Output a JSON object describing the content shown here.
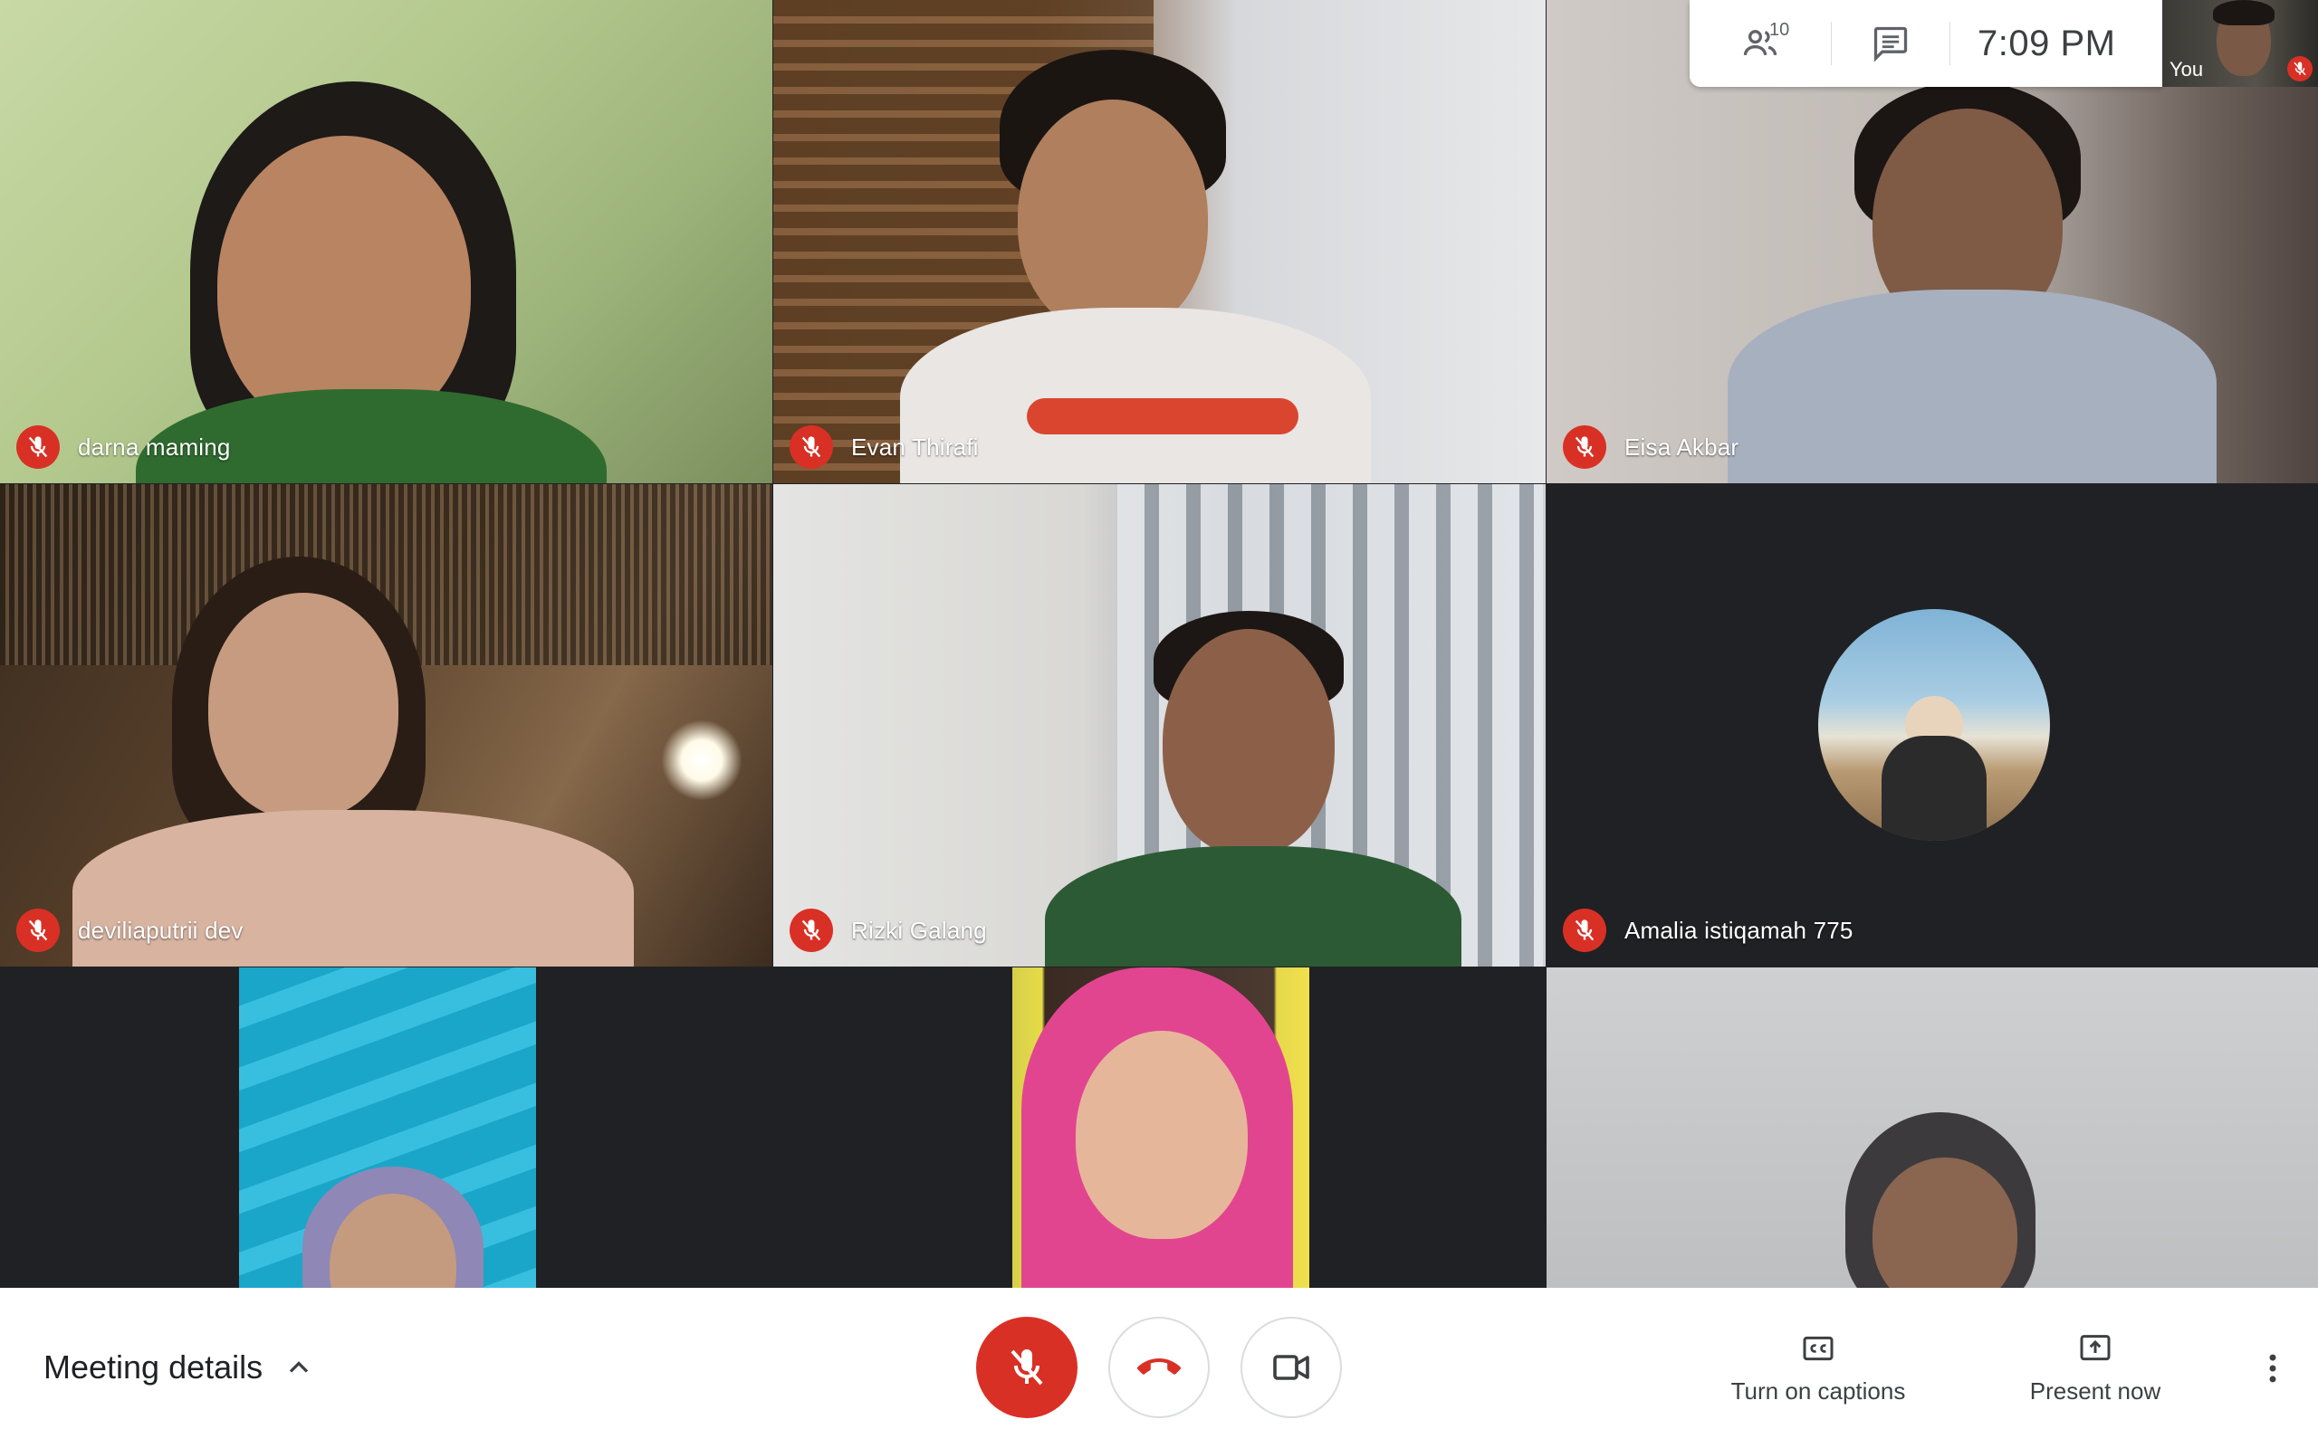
{
  "top_bar": {
    "participants_count": "10",
    "clock": "7:09 PM",
    "self_label": "You"
  },
  "participants": [
    {
      "name": "darna maming",
      "muted": true
    },
    {
      "name": "Evan Thirafi",
      "muted": true
    },
    {
      "name": "Eisa Akbar",
      "muted": true
    },
    {
      "name": "deviliaputrii dev",
      "muted": true
    },
    {
      "name": "Rizki Galang",
      "muted": true
    },
    {
      "name": "Amalia istiqamah 775",
      "muted": true
    }
  ],
  "bottom_bar": {
    "meeting_details_label": "Meeting details",
    "captions_label": "Turn on captions",
    "present_label": "Present now"
  },
  "colors": {
    "mute_red": "#d93025",
    "bar_bg": "#ffffff",
    "grid_bg": "#202124"
  }
}
